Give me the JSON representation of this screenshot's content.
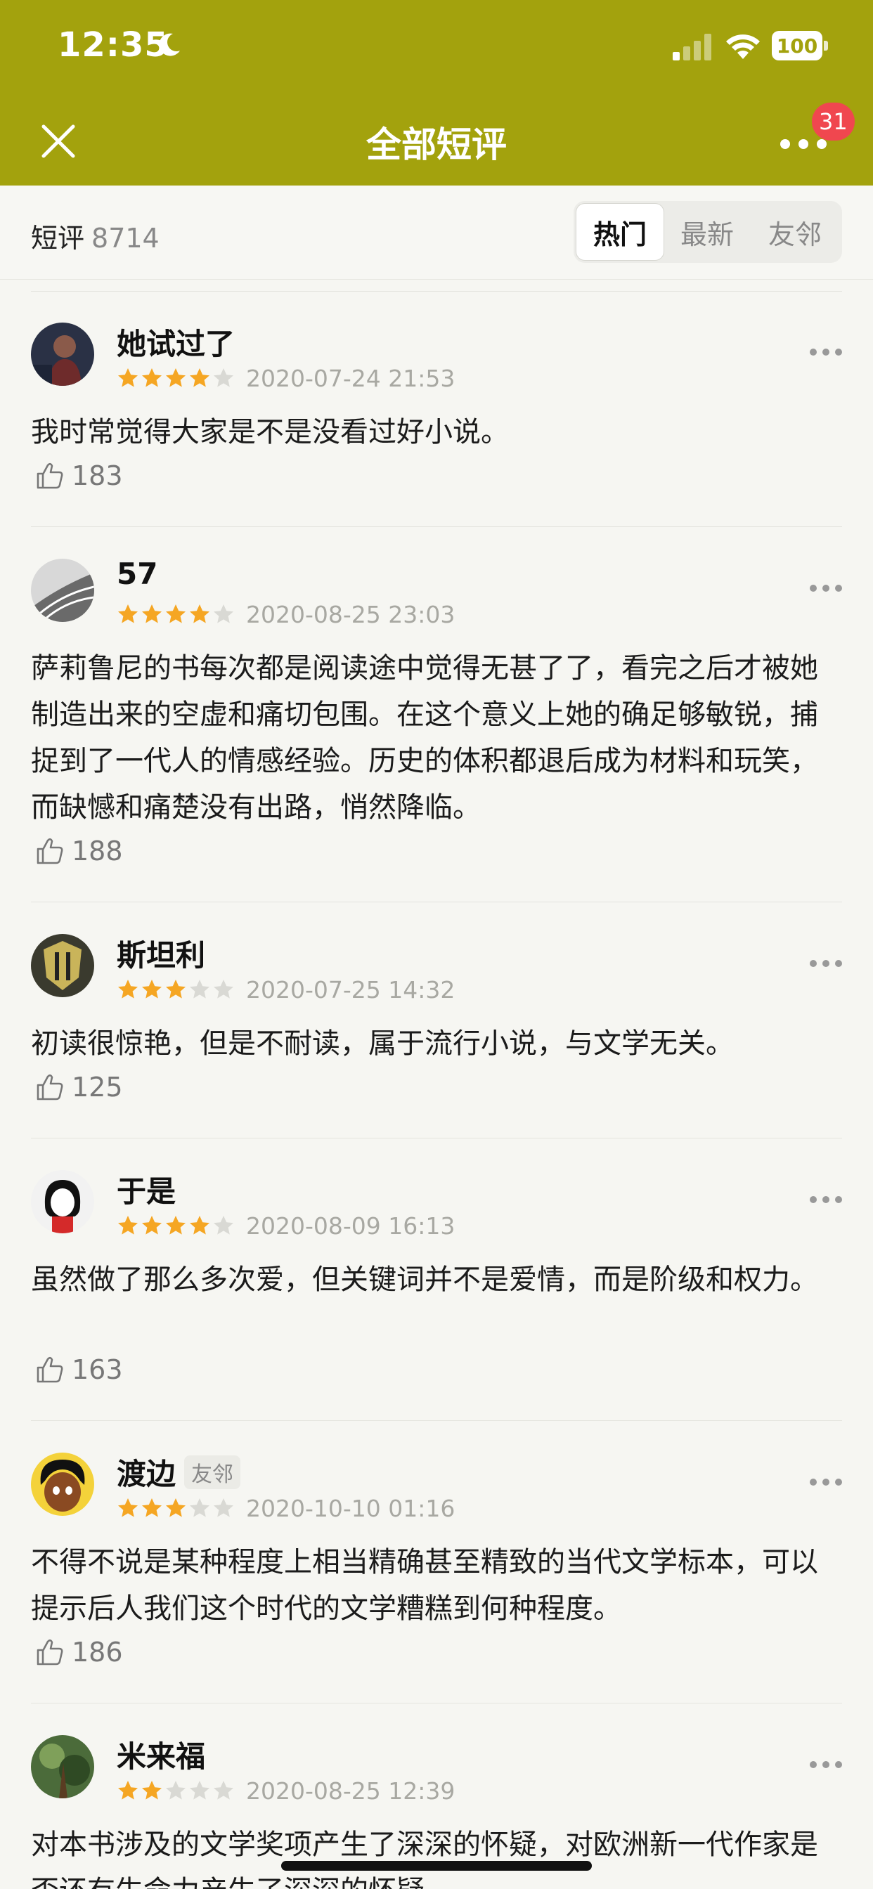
{
  "status_bar": {
    "time": "12:35",
    "battery": "100"
  },
  "nav": {
    "title": "全部短评",
    "badge": "31"
  },
  "subheader": {
    "label": "短评",
    "count": "8714",
    "tabs": [
      {
        "label": "热门"
      },
      {
        "label": "最新"
      },
      {
        "label": "友邻"
      }
    ]
  },
  "reviews": [
    {
      "user": "她试过了",
      "rating": 4,
      "date": "2020-07-24 21:53",
      "text": "我时常觉得大家是不是没看过好小说。",
      "likes": "183"
    },
    {
      "user": "57",
      "rating": 4,
      "date": "2020-08-25 23:03",
      "text": "萨莉鲁尼的书每次都是阅读途中觉得无甚了了，看完之后才被她制造出来的空虚和痛切包围。在这个意义上她的确足够敏锐，捕捉到了一代人的情感经验。历史的体积都退后成为材料和玩笑，而缺憾和痛楚没有出路，悄然降临。",
      "likes": "188"
    },
    {
      "user": "斯坦利",
      "rating": 3,
      "date": "2020-07-25 14:32",
      "text": "初读很惊艳，但是不耐读，属于流行小说，与文学无关。",
      "likes": "125"
    },
    {
      "user": "于是",
      "rating": 4,
      "date": "2020-08-09 16:13",
      "text": "虽然做了那么多次爱，但关键词并不是爱情，而是阶级和权力。",
      "likes": "163"
    },
    {
      "user": "渡边",
      "tag": "友邻",
      "rating": 3,
      "date": "2020-10-10 01:16",
      "text": "不得不说是某种程度上相当精确甚至精致的当代文学标本，可以提示后人我们这个时代的文学糟糕到何种程度。",
      "likes": "186"
    },
    {
      "user": "米来福",
      "rating": 2,
      "date": "2020-08-25 12:39",
      "text": "对本书涉及的文学奖项产生了深深的怀疑，对欧洲新一代作家是否还有生命力产生了深深的怀疑",
      "likes": ""
    }
  ],
  "colors": {
    "header": "#a3a20d",
    "star_on": "#f5a623",
    "star_off": "#d9d9d4",
    "badge": "#f0474f"
  }
}
